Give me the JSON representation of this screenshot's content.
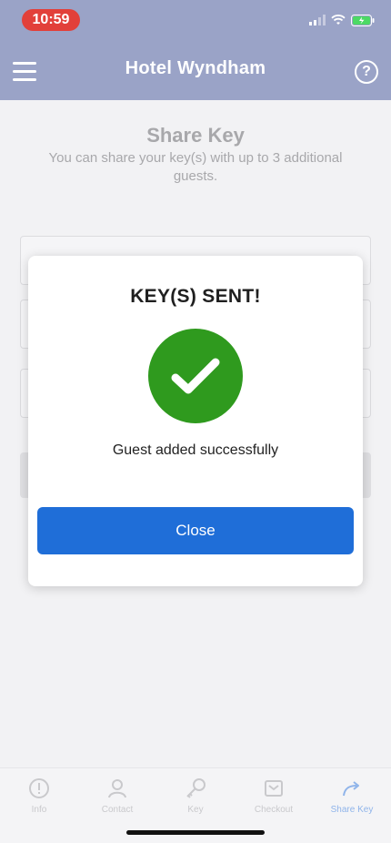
{
  "status_bar": {
    "time": "10:59"
  },
  "header": {
    "title": "Hotel Wyndham",
    "menu_icon": "hamburger-menu-icon",
    "help_icon": "question-circle-icon"
  },
  "page": {
    "title": "Share Key",
    "subtitle": "You can share your key(s) with up to 3 additional guests."
  },
  "modal": {
    "title": "KEY(S) SENT!",
    "icon": "checkmark-icon",
    "message": "Guest added successfully",
    "close_label": "Close",
    "accent_color": "#2f9a1e",
    "button_color": "#1f6ed8"
  },
  "tabs": [
    {
      "label": "Info",
      "icon": "info-icon",
      "active": false
    },
    {
      "label": "Contact",
      "icon": "person-icon",
      "active": false
    },
    {
      "label": "Key",
      "icon": "key-icon",
      "active": false
    },
    {
      "label": "Checkout",
      "icon": "checkout-icon",
      "active": false
    },
    {
      "label": "Share Key",
      "icon": "share-arrow-icon",
      "active": true
    }
  ]
}
